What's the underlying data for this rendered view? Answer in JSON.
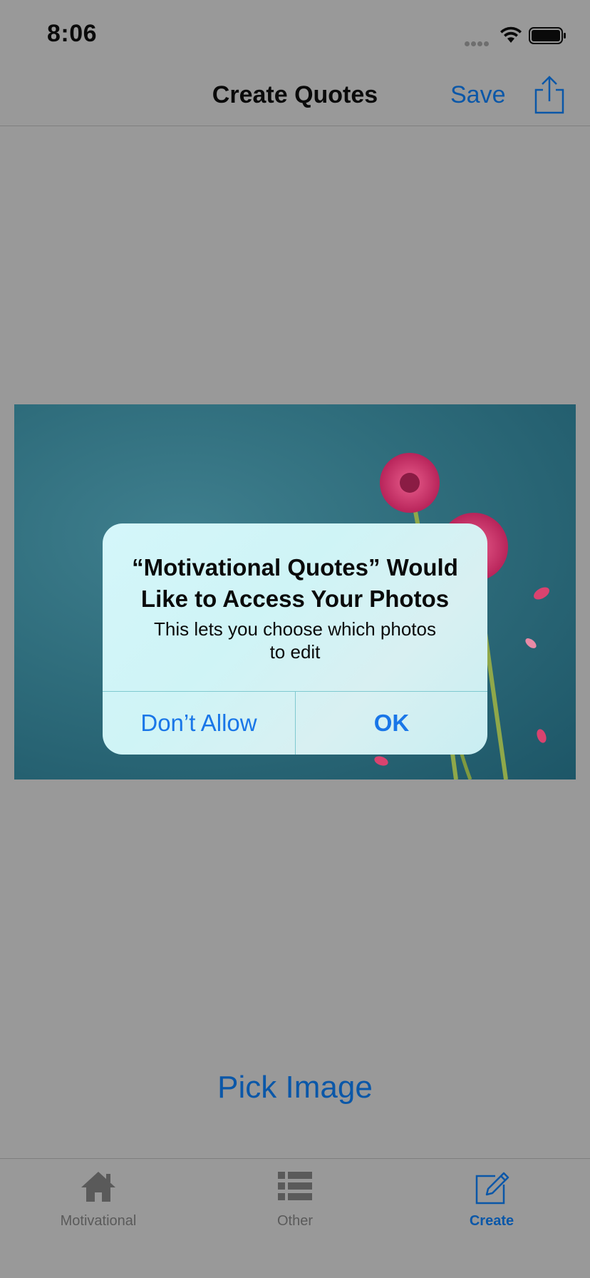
{
  "status_bar": {
    "time": "8:06"
  },
  "nav": {
    "title": "Create Quotes",
    "save_label": "Save",
    "share_icon": "share-icon"
  },
  "alert": {
    "title": "“Motivational Quotes” Would Like to Access Your Photos",
    "message": "This lets you choose which photos to edit",
    "deny_label": "Don’t Allow",
    "ok_label": "OK"
  },
  "main": {
    "pick_image_label": "Pick Image"
  },
  "tab_bar": {
    "items": [
      {
        "label": "Motivational",
        "icon": "home-icon",
        "active": false
      },
      {
        "label": "Other",
        "icon": "list-icon",
        "active": false
      },
      {
        "label": "Create",
        "icon": "compose-icon",
        "active": true
      }
    ]
  },
  "colors": {
    "tint": "#0a57a8",
    "alert_button": "#1976e8",
    "dim_background": "#999999"
  }
}
